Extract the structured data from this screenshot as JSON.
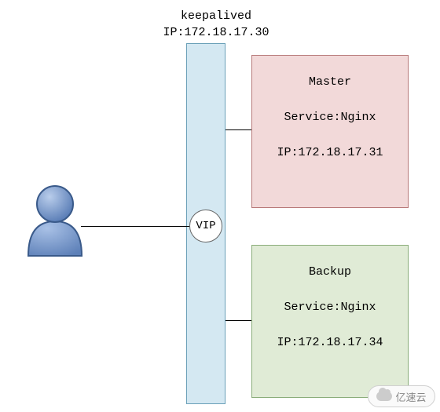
{
  "header": {
    "title": "keepalived",
    "ip_label": "IP:172.18.17.30"
  },
  "vip": {
    "label": "VIP"
  },
  "master": {
    "title": "Master",
    "service": "Service:Nginx",
    "ip": "IP:172.18.17.31"
  },
  "backup": {
    "title": "Backup",
    "service": "Service:Nginx",
    "ip": "IP:172.18.17.34"
  },
  "watermark": {
    "text": "亿速云"
  },
  "colors": {
    "keepalived_bg": "#d4e8f2",
    "master_bg": "#f2d9d9",
    "backup_bg": "#e0ebd6",
    "user_fill": "#6b8fc7",
    "user_stroke": "#3a5a8a"
  }
}
